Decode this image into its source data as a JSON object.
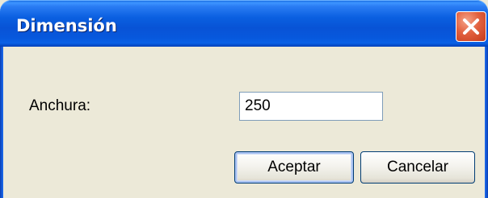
{
  "dialog": {
    "title": "Dimensión",
    "close_icon": "close-icon",
    "colors": {
      "titlebar": "#0a5fe0",
      "close": "#e2613f",
      "background": "#ece9d8"
    }
  },
  "form": {
    "width_label": "Anchura:",
    "width_value": "250"
  },
  "buttons": {
    "accept_label": "Aceptar",
    "cancel_label": "Cancelar"
  }
}
